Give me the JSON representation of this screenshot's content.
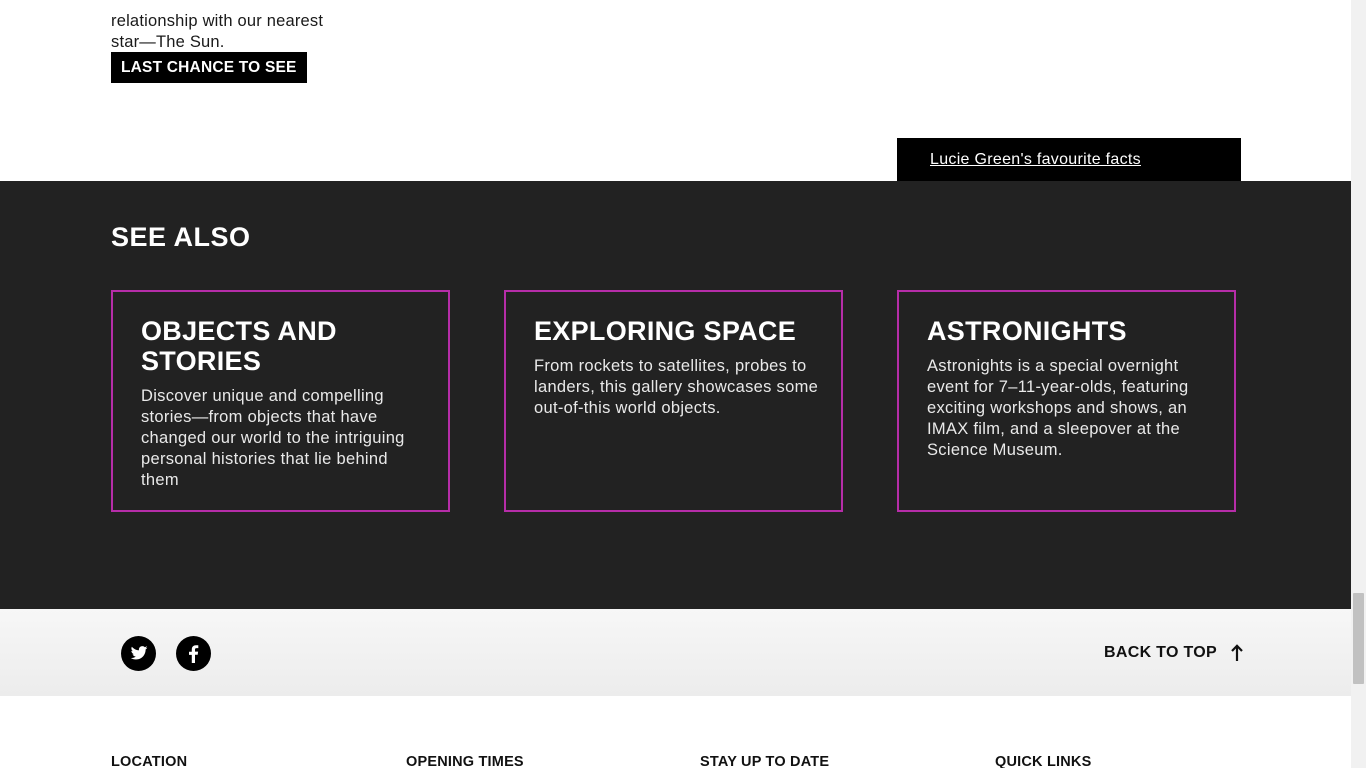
{
  "intro": {
    "line1": "relationship with our nearest",
    "line2": "star—The Sun."
  },
  "cta_label": "LAST CHANCE TO SEE",
  "facts_link": "Lucie Green's favourite facts",
  "see_also": {
    "title": "SEE ALSO",
    "cards": [
      {
        "title": "OBJECTS AND STORIES",
        "description": "Discover unique and compelling stories—from objects that have changed our world to the intriguing personal histories that lie behind them"
      },
      {
        "title": "EXPLORING SPACE",
        "description": "From rockets to satellites, probes to landers, this gallery showcases some out-of-this world objects."
      },
      {
        "title": "ASTRONIGHTS",
        "description": "Astronights is a special overnight event for 7–11-year-olds, featuring exciting workshops and shows, an IMAX film, and a sleepover at the Science Museum."
      }
    ]
  },
  "social": {
    "icons": [
      "twitter-icon",
      "facebook-icon"
    ]
  },
  "back_to_top": "BACK TO TOP",
  "footer": {
    "headings": [
      "LOCATION",
      "OPENING TIMES",
      "STAY UP TO DATE",
      "QUICK LINKS"
    ]
  },
  "colors": {
    "dark_section": "#222222",
    "card_border": "#b62da8",
    "cta_background": "#000000"
  }
}
